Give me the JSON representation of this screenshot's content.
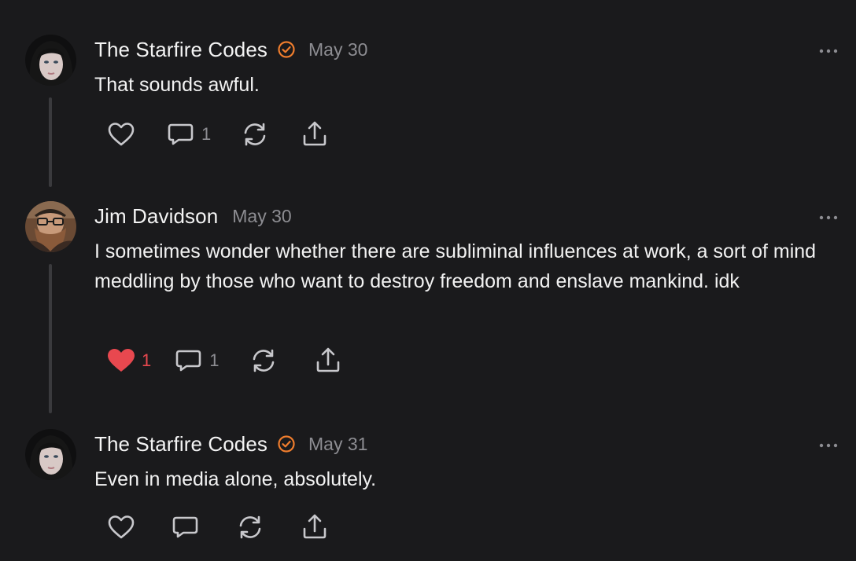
{
  "posts": [
    {
      "author": "The Starfire Codes",
      "verified": true,
      "date": "May 30",
      "text": "That sounds awful.",
      "likes": "",
      "liked": false,
      "replies": "1"
    },
    {
      "author": "Jim Davidson",
      "verified": false,
      "date": "May 30",
      "text": "I sometimes wonder whether there are subliminal influences at work, a sort of mind meddling by those who want to destroy freedom and enslave mankind. idk",
      "likes": "1",
      "liked": true,
      "replies": "1"
    },
    {
      "author": "The Starfire Codes",
      "verified": true,
      "date": "May 31",
      "text": "Even in media alone, absolutely.",
      "likes": "",
      "liked": false,
      "replies": ""
    }
  ],
  "colors": {
    "background": "#1a1a1c",
    "verified_badge": "#ef7d2d",
    "liked_heart": "#e8484f",
    "muted_text": "#8d8d92"
  },
  "icons": [
    "heart-icon",
    "comment-icon",
    "restack-icon",
    "share-icon",
    "more-options-icon",
    "verified-badge-icon"
  ]
}
